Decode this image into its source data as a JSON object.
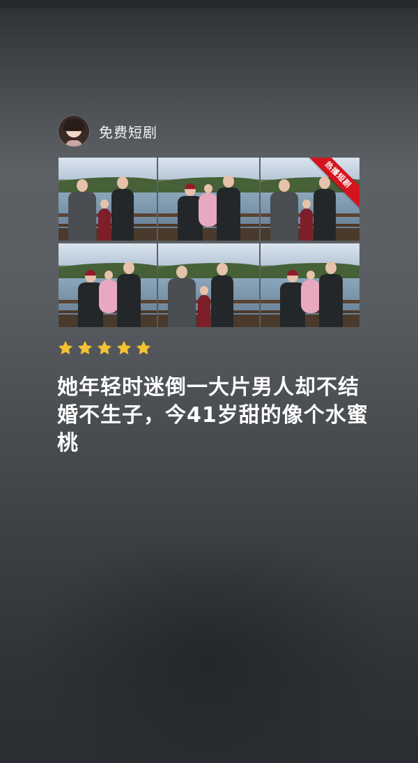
{
  "publisher": {
    "name": "免费短剧"
  },
  "photo_grid": {
    "badge": "热播短剧"
  },
  "rating": {
    "stars": 5,
    "max": 5,
    "star_color": "#f2c232"
  },
  "headline": "她年轻时迷倒一大片男人却不结婚不生子，今41岁甜的像个水蜜桃"
}
